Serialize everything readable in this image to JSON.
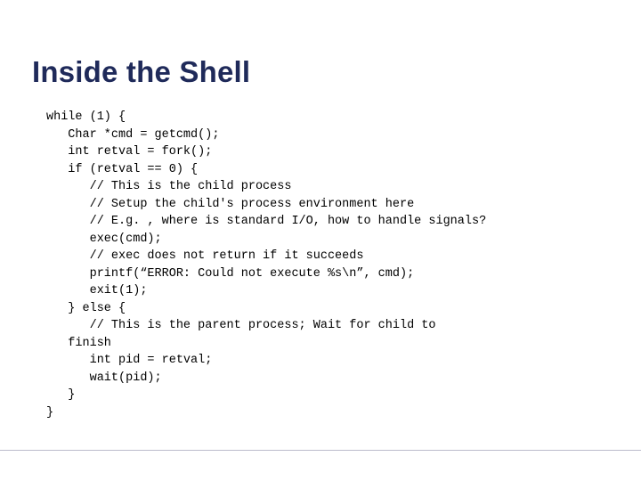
{
  "title": "Inside the Shell",
  "code": {
    "l01": "while (1) {",
    "l02": "   Char *cmd = getcmd();",
    "l03": "   int retval = fork();",
    "l04": "   if (retval == 0) {",
    "l05": "      // This is the child process",
    "l06": "      // Setup the child's process environment here",
    "l07": "      // E.g. , where is standard I/O, how to handle signals?",
    "l08": "      exec(cmd);",
    "l09": "      // exec does not return if it succeeds",
    "l10": "      printf(“ERROR: Could not execute %s\\n”, cmd);",
    "l11": "      exit(1);",
    "l12": "   } else {",
    "l13": "      // This is the parent process; Wait for child to",
    "l14": "   finish",
    "l15": "      int pid = retval;",
    "l16": "      wait(pid);",
    "l17": "   }",
    "l18": "}"
  }
}
